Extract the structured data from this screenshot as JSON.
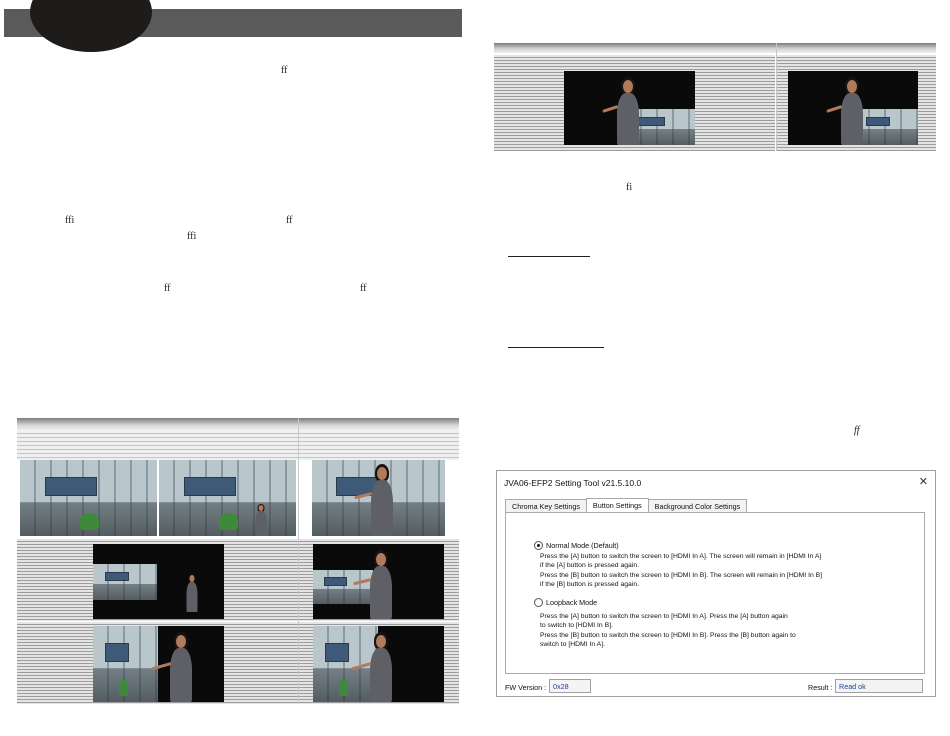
{
  "glyphs": {
    "left_1": "ff",
    "left_2a": "ffi",
    "left_2b": "ff",
    "left_3": "ffi",
    "left_4a": "ff",
    "left_4b": "ff",
    "right_1": "fi",
    "right_2": "ff"
  },
  "setting_tool": {
    "title": "JVA06-EFP2 Setting Tool v21.5.10.0",
    "close_glyph": "✕",
    "tabs": [
      {
        "label": "Chroma Key Settings",
        "active": false
      },
      {
        "label": "Button Settings",
        "active": true
      },
      {
        "label": "Background Color Settings",
        "active": false
      }
    ],
    "normal_mode": {
      "label": "Normal Mode (Default)",
      "selected": true,
      "desc_1": "Press the [A] button to switch the screen to [HDMI In A]. The screen will remain in [HDMI In A]",
      "desc_2": "if the [A] button is pressed again.",
      "desc_3": "Press the [B] button to switch the screen to [HDMI In B]. The screen will remain in [HDMI In  B]",
      "desc_4": "if the [B] button is pressed again."
    },
    "loopback_mode": {
      "label": "Loopback Mode",
      "selected": false,
      "desc_1": "Press the [A] button to switch the screen to [HDMI In A]. Press the [A] button again",
      "desc_2": "to switch to [HDMI In B].",
      "desc_3": "Press the [B] button to switch the screen to [HDMI In B]. Press the  [B] button again to",
      "desc_4": "switch to [HDMI In A]."
    },
    "fw_version_label": "FW Version :",
    "fw_version_value": "0x28",
    "result_label": "Result :",
    "result_value": "Read ok"
  }
}
